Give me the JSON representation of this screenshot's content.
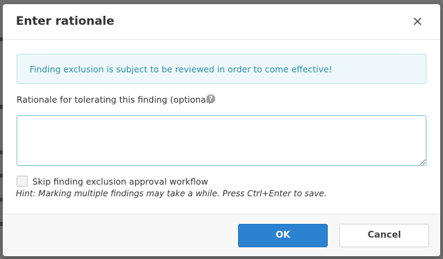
{
  "dialog": {
    "title": "Enter rationale",
    "close_icon": "close-icon"
  },
  "alert": {
    "message": "Finding exclusion is subject to be reviewed in order to come effective!",
    "text_color": "#2a8fa8",
    "background_color": "#eef8fa"
  },
  "rationale": {
    "label": "Rationale for tolerating this finding (optional)",
    "help_icon": "question-circle-icon",
    "help_glyph": "?",
    "value": "",
    "placeholder": ""
  },
  "skip_workflow": {
    "label": "Skip finding exclusion approval workflow",
    "checked": false
  },
  "hint": "Hint: Marking multiple findings may take a while. Press Ctrl+Enter to save.",
  "footer": {
    "ok_label": "OK",
    "cancel_label": "Cancel",
    "primary_color": "#2a82d1"
  }
}
